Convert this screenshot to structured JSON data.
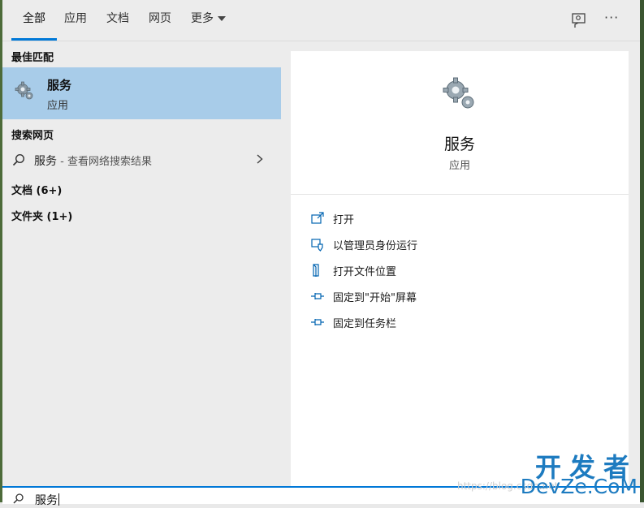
{
  "tabs": [
    {
      "label": "全部",
      "active": true
    },
    {
      "label": "应用"
    },
    {
      "label": "文档"
    },
    {
      "label": "网页"
    },
    {
      "label": "更多"
    }
  ],
  "toolbar": {
    "feedback_icon": "feedback-icon",
    "more_icon": "more-options-icon",
    "more_glyph": "···"
  },
  "left": {
    "best_match_header": "最佳匹配",
    "best_match": {
      "title": "服务",
      "subtitle": "应用",
      "icon": "gear-icon"
    },
    "web_header": "搜索网页",
    "web_result": {
      "query": "服务",
      "suffix": " - 查看网络搜索结果"
    },
    "documents": "文档 (6+)",
    "folders": "文件夹 (1+)"
  },
  "right": {
    "title": "服务",
    "subtitle": "应用",
    "actions": [
      {
        "label": "打开",
        "icon": "open-icon"
      },
      {
        "label": "以管理员身份运行",
        "icon": "shield-icon"
      },
      {
        "label": "打开文件位置",
        "icon": "file-location-icon"
      },
      {
        "label": "固定到\"开始\"屏幕",
        "icon": "pin-icon"
      },
      {
        "label": "固定到任务栏",
        "icon": "pin-icon"
      }
    ]
  },
  "search": {
    "value": "服务",
    "icon": "search-icon"
  },
  "watermark": {
    "cn": "开发者",
    "en": "DevZe.CoM",
    "url": "https://blog.csdn.net"
  },
  "colors": {
    "accent": "#0078d7",
    "selection": "#a8cce9",
    "watermark": "#1d7bc0"
  }
}
